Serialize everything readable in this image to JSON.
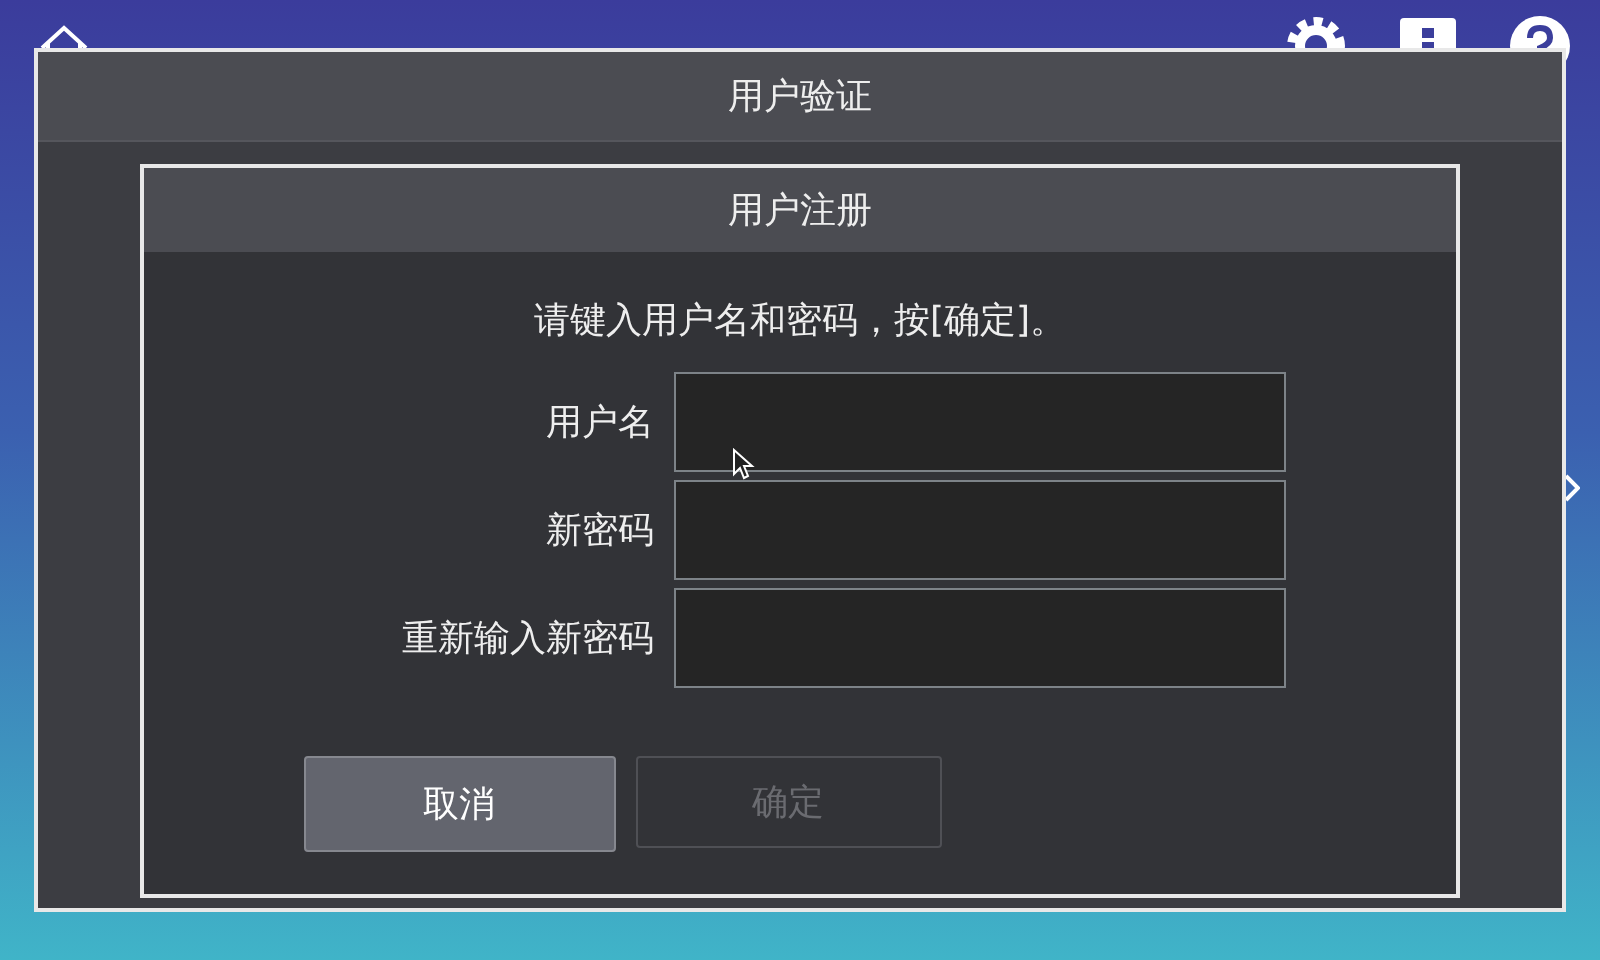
{
  "dialog": {
    "title": "用户验证"
  },
  "form": {
    "title": "用户注册",
    "instruction": "请键入用户名和密码，按[确定]。",
    "fields": [
      {
        "label": "用户名"
      },
      {
        "label": "新密码"
      },
      {
        "label": "重新输入新密码"
      }
    ],
    "buttons": [
      {
        "label": "取消",
        "disabled": false
      },
      {
        "label": "确定",
        "disabled": true
      }
    ]
  }
}
